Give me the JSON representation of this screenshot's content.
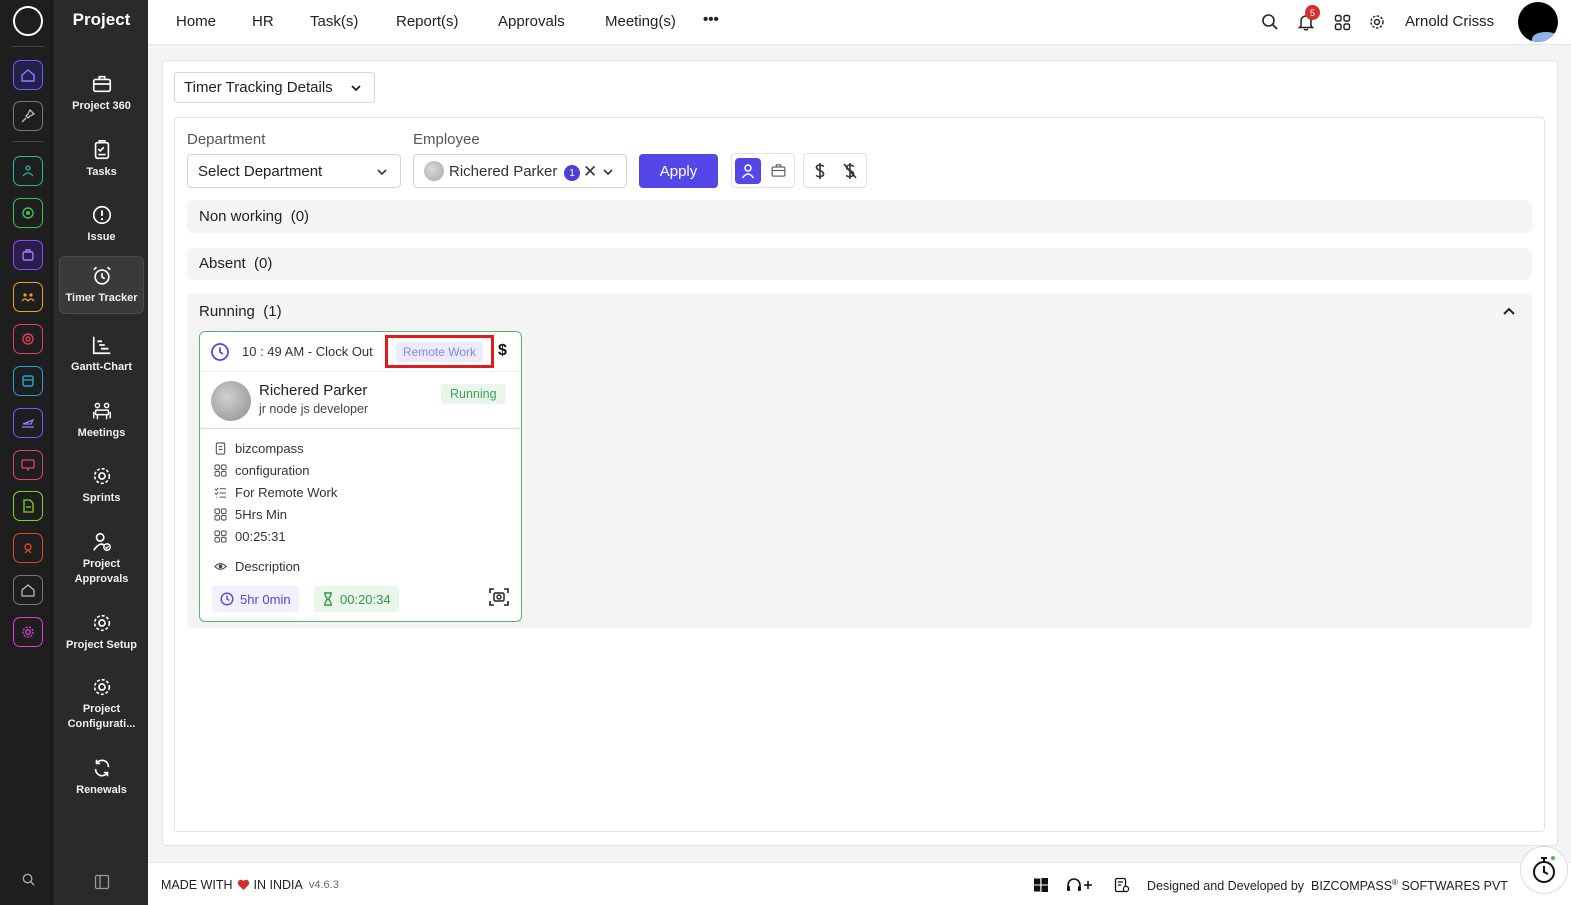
{
  "sidebar": {
    "title": "Project",
    "items": [
      {
        "label": "Project 360"
      },
      {
        "label": "Tasks"
      },
      {
        "label": "Issue"
      },
      {
        "label": "Timer Tracker"
      },
      {
        "label": "Gantt-Chart"
      },
      {
        "label": "Meetings"
      },
      {
        "label": "Sprints"
      },
      {
        "label": "Project Approvals"
      },
      {
        "label": "Project Setup"
      },
      {
        "label": "Project Configurati..."
      },
      {
        "label": "Renewals"
      }
    ],
    "active_item": "Timer Tracker"
  },
  "topnav": {
    "items": [
      "Home",
      "HR",
      "Task(s)",
      "Report(s)",
      "Approvals",
      "Meeting(s)"
    ],
    "more_label": "•••",
    "notification_count": "5",
    "user_name": "Arnold Crisss"
  },
  "page": {
    "view_select": "Timer Tracking Details",
    "filters": {
      "department_label": "Department",
      "department_placeholder": "Select Department",
      "employee_label": "Employee",
      "employee_value": "Richered Parker",
      "employee_count": "1",
      "apply_label": "Apply"
    },
    "sections": [
      {
        "title": "Non working",
        "count": "(0)"
      },
      {
        "title": "Absent",
        "count": "(0)"
      },
      {
        "title": "Running",
        "count": "(1)"
      }
    ]
  },
  "timer_card": {
    "clock_text": "10 : 49 AM - Clock Out",
    "work_mode": "Remote Work",
    "billing_symbol": "$",
    "employee_name": "Richered Parker",
    "employee_role": "jr node js developer",
    "status": "Running",
    "details": [
      "bizcompass",
      "configuration",
      "For Remote Work",
      "5Hrs Min",
      "00:25:31"
    ],
    "description_label": "Description",
    "planned_time": "5hr 0min",
    "spent_time": "00:20:34"
  },
  "footer": {
    "made_prefix": "MADE WITH",
    "made_suffix": "IN INDIA",
    "version": "v4.6.3",
    "credit_prefix": "Designed and Developed by",
    "credit_brand": "BIZCOMPASS",
    "credit_mark": "®",
    "credit_suffix": "SOFTWARES PVT"
  },
  "colors": {
    "accent": "#5546e8",
    "running_border": "#55b868",
    "highlight_box": "#e21c1c",
    "sidebar_bg": "#2a2a2a",
    "rail_bg": "#1e1e1e"
  }
}
